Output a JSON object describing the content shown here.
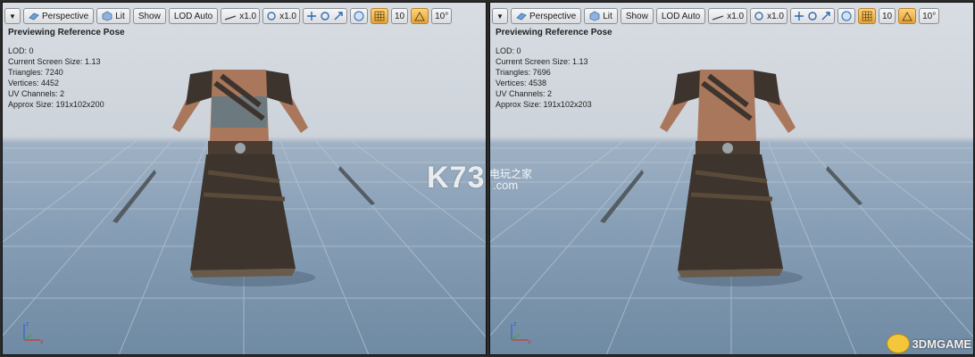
{
  "viewports": [
    {
      "id": "left",
      "toolbar": {
        "perspective_label": "Perspective",
        "lit_label": "Lit",
        "show_label": "Show",
        "lod_label": "LOD Auto",
        "speed1_label": "x1.0",
        "speed2_label": "x1.0",
        "grid_value": "10",
        "angle_value": "10°"
      },
      "title": "Previewing Reference Pose",
      "stats": {
        "lod": "LOD: 0",
        "screen_size": "Current Screen Size: 1.13",
        "triangles": "Triangles: 7240",
        "vertices": "Vertices: 4452",
        "uv_channels": "UV Channels: 2",
        "approx_size": "Approx Size: 191x102x200"
      },
      "skin_color": "#a9775c",
      "top_color": "#6c7a80"
    },
    {
      "id": "right",
      "toolbar": {
        "perspective_label": "Perspective",
        "lit_label": "Lit",
        "show_label": "Show",
        "lod_label": "LOD Auto",
        "speed1_label": "x1.0",
        "speed2_label": "x1.0",
        "grid_value": "10",
        "angle_value": "10°"
      },
      "title": "Previewing Reference Pose",
      "stats": {
        "lod": "LOD: 0",
        "screen_size": "Current Screen Size: 1.13",
        "triangles": "Triangles: 7696",
        "vertices": "Vertices: 4538",
        "uv_channels": "UV Channels: 2",
        "approx_size": "Approx Size: 191x102x203"
      },
      "skin_color": "#a9775c",
      "top_color": "#a9775c"
    }
  ],
  "watermark": {
    "k73": "K73",
    "cn_text": "电玩之家",
    "com_text": ".com",
    "brand": "3DMGAME"
  },
  "colors": {
    "toolbar_active": "#e0a23c",
    "leather": "#3d342d",
    "floor": "#8aa1b8"
  }
}
